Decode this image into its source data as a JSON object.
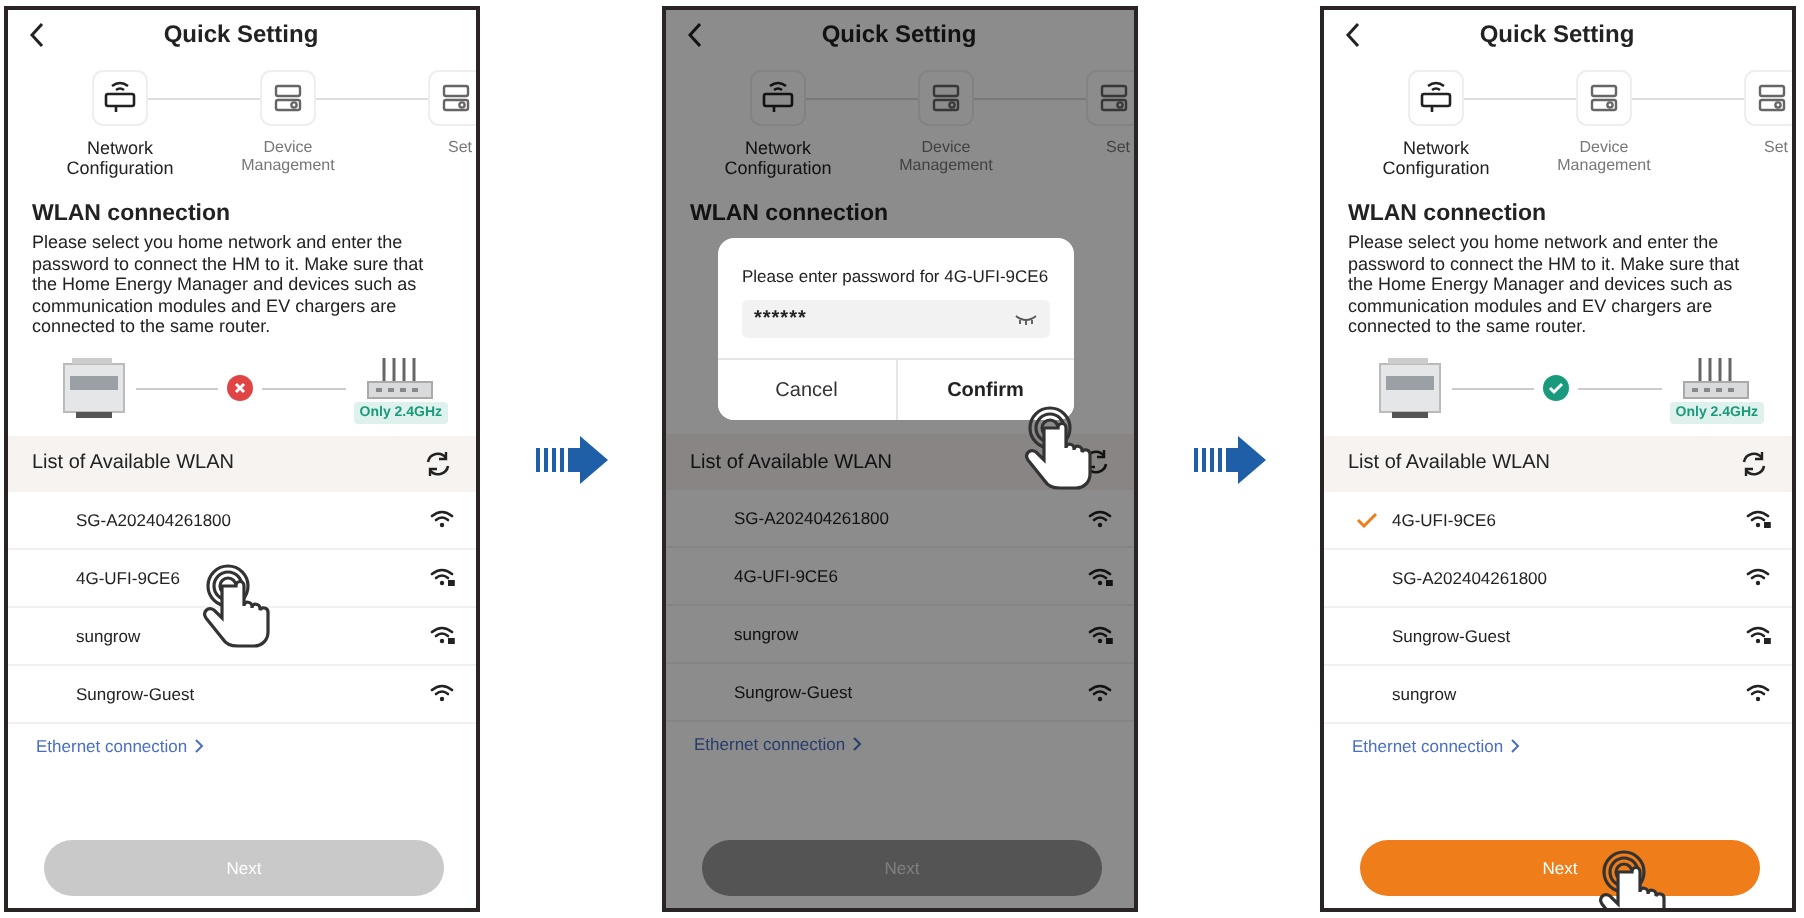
{
  "screens": [
    {
      "title": "Quick Setting",
      "steps": [
        {
          "label": "Network Configuration",
          "selected": true
        },
        {
          "label": "Device Management",
          "selected": false
        },
        {
          "label": "Set",
          "selected": false
        }
      ],
      "heading": "WLAN connection",
      "description": "Please select you home network and enter the password to connect the HM to it. Make sure that the Home Energy Manager and devices such as communication modules and EV chargers are connected to the same router.",
      "connection": {
        "connected": false,
        "badge": "Only 2.4GHz"
      },
      "list_title": "List of Available WLAN",
      "networks": [
        {
          "name": "SG-A202404261800",
          "selected": false,
          "locked": false,
          "tapped": false
        },
        {
          "name": "4G-UFI-9CE6",
          "selected": false,
          "locked": true,
          "tapped": true
        },
        {
          "name": "sungrow",
          "selected": false,
          "locked": true,
          "tapped": false
        },
        {
          "name": "Sungrow-Guest",
          "selected": false,
          "locked": false,
          "tapped": false
        }
      ],
      "ethernet_link": "Ethernet connection",
      "next": {
        "label": "Next",
        "disabled": true,
        "tapped": false
      }
    },
    {
      "title": "Quick Setting",
      "steps": [
        {
          "label": "Network Configuration",
          "selected": true
        },
        {
          "label": "Device Management",
          "selected": false
        },
        {
          "label": "Set",
          "selected": false
        }
      ],
      "heading": "WLAN connection",
      "list_title": "List of Available WLAN",
      "networks": [
        {
          "name": "SG-A202404261800",
          "selected": false,
          "locked": false,
          "tapped": false
        },
        {
          "name": "4G-UFI-9CE6",
          "selected": false,
          "locked": true,
          "tapped": false
        },
        {
          "name": "sungrow",
          "selected": false,
          "locked": true,
          "tapped": false
        },
        {
          "name": "Sungrow-Guest",
          "selected": false,
          "locked": false,
          "tapped": false
        }
      ],
      "ethernet_link": "Ethernet connection",
      "next": {
        "label": "Next",
        "disabled": true,
        "tapped": false
      },
      "dialog": {
        "message": "Please enter password for 4G-UFI-9CE6",
        "value": "******",
        "cancel": "Cancel",
        "confirm": "Confirm",
        "confirm_tapped": true
      }
    },
    {
      "title": "Quick Setting",
      "steps": [
        {
          "label": "Network Configuration",
          "selected": true
        },
        {
          "label": "Device Management",
          "selected": false
        },
        {
          "label": "Set",
          "selected": false
        }
      ],
      "heading": "WLAN connection",
      "description": "Please select you home network and enter the password to connect the HM to it. Make sure that the Home Energy Manager and devices such as communication modules and EV chargers are connected to the same router.",
      "connection": {
        "connected": true,
        "badge": "Only 2.4GHz"
      },
      "list_title": "List of Available WLAN",
      "networks": [
        {
          "name": "4G-UFI-9CE6",
          "selected": true,
          "locked": true,
          "tapped": false
        },
        {
          "name": "SG-A202404261800",
          "selected": false,
          "locked": false,
          "tapped": false
        },
        {
          "name": "Sungrow-Guest",
          "selected": false,
          "locked": true,
          "tapped": false
        },
        {
          "name": "sungrow",
          "selected": false,
          "locked": false,
          "tapped": false
        }
      ],
      "ethernet_link": "Ethernet connection",
      "next": {
        "label": "Next",
        "disabled": false,
        "tapped": true
      }
    }
  ]
}
